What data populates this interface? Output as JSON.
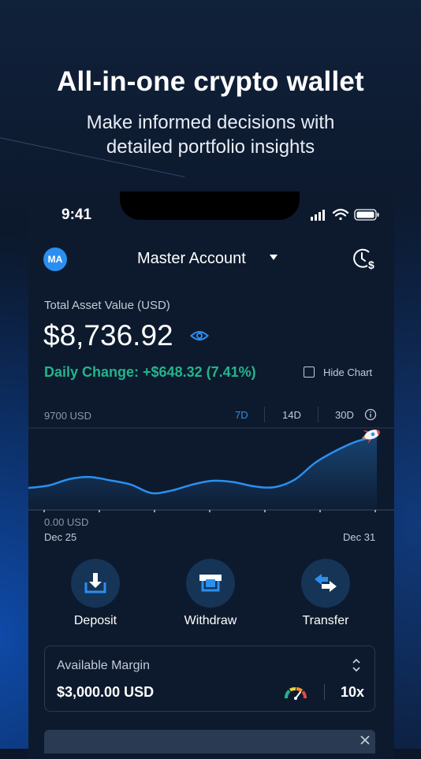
{
  "promo": {
    "headline": "All-in-one crypto wallet",
    "subheadline_line1": "Make informed decisions with",
    "subheadline_line2": "detailed portfolio insights"
  },
  "status_bar": {
    "time": "9:41",
    "icons": [
      "signal-icon",
      "wifi-icon",
      "battery-icon"
    ]
  },
  "header": {
    "avatar_initials": "MA",
    "account_name": "Master Account",
    "history_icon": "clock-dollar-icon"
  },
  "portfolio": {
    "total_label": "Total Asset Value (USD)",
    "total_value": "$8,736.92",
    "daily_change": "Daily Change: +$648.32 (7.41%)",
    "hide_chart_label": "Hide Chart",
    "hide_chart_checked": false
  },
  "chart_controls": {
    "ranges": [
      "7D",
      "14D",
      "30D"
    ],
    "selected": "7D"
  },
  "chart_data": {
    "type": "area",
    "x_start_label": "Dec 25",
    "x_end_label": "Dec 31",
    "y_max_label": "9700 USD",
    "y_min_label": "0.00 USD",
    "ylim": [
      0,
      9700
    ],
    "values": [
      2600,
      2900,
      3650,
      3900,
      3500,
      3000,
      2000,
      2300,
      3000,
      3450,
      3300,
      2800,
      2700,
      3600,
      5600,
      7000,
      8100,
      8736.92
    ],
    "line_color": "#2b8ff0",
    "grid": false,
    "end_marker": "rocket-icon"
  },
  "actions": [
    {
      "label": "Deposit",
      "icon": "deposit-icon"
    },
    {
      "label": "Withdraw",
      "icon": "withdraw-icon"
    },
    {
      "label": "Transfer",
      "icon": "transfer-icon"
    }
  ],
  "margin": {
    "label": "Available Margin",
    "value": "$3,000.00 USD",
    "leverage": "10x"
  },
  "colors": {
    "accent": "#2b8ff0",
    "positive": "#22b58a",
    "background": "#0b1628",
    "card": "#0d1a2e"
  }
}
